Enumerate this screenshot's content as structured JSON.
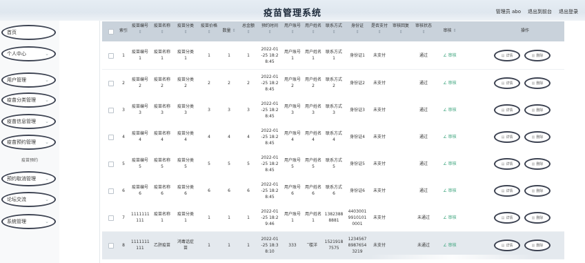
{
  "header": {
    "title": "疫苗管理系统",
    "user_label": "管理员 abo",
    "exit_to_front": "退出到前台",
    "logout": "退出登录"
  },
  "sidebar": {
    "items": [
      {
        "label": "首页",
        "chevron": ""
      },
      {
        "label": "个人中心",
        "chevron": "⌄"
      },
      {
        "label": "用户管理",
        "chevron": "⌄"
      },
      {
        "label": "疫苗分类管理",
        "chevron": "⌄"
      },
      {
        "label": "疫苗信息管理",
        "chevron": "⌄"
      },
      {
        "label": "疫苗预约管理",
        "chevron": "⌄"
      },
      {
        "label": "预约取消管理",
        "chevron": "⌄"
      },
      {
        "label": "论坛交流",
        "chevron": "⌄"
      },
      {
        "label": "系统管理",
        "chevron": "⌄"
      }
    ],
    "sub_item": "疫苗预约"
  },
  "table": {
    "columns": {
      "index": "索引",
      "vaccine_no": "疫苗编号",
      "vaccine_name": "疫苗名称",
      "vaccine_cat": "疫苗分类",
      "vaccine_price": "疫苗价格",
      "quantity": "数量",
      "total": "总金额",
      "time": "预约时间",
      "account": "用户账号",
      "name": "用户姓名",
      "contact": "联系方式",
      "idcard": "身份证",
      "paid": "是否支付",
      "reply": "审核回复",
      "status": "审核状态",
      "audit": "审核",
      "ops": "操作"
    },
    "sort_glyph": "⇕",
    "edit_label": "审核",
    "detail_label": "详情",
    "delete_label": "删除",
    "rows": [
      {
        "idx": "1",
        "no": "疫苗编号\n1",
        "name": "疫苗名称\n1",
        "cat": "疫苗分类\n1",
        "price": "1",
        "qty": "1",
        "total": "1",
        "time": "2022-01\n-25 18:2\n8:45",
        "acct": "用户账号\n1",
        "uname": "用户姓名\n1",
        "contact": "联系方式\n1",
        "idcard": "身份证1",
        "paid": "未支付",
        "reply": "",
        "status": "通过"
      },
      {
        "idx": "2",
        "no": "疫苗编号\n2",
        "name": "疫苗名称\n2",
        "cat": "疫苗分类\n2",
        "price": "2",
        "qty": "2",
        "total": "2",
        "time": "2022-01\n-25 18:2\n8:45",
        "acct": "用户账号\n2",
        "uname": "用户姓名\n2",
        "contact": "联系方式\n2",
        "idcard": "身份证2",
        "paid": "未支付",
        "reply": "",
        "status": "通过"
      },
      {
        "idx": "3",
        "no": "疫苗编号\n3",
        "name": "疫苗名称\n3",
        "cat": "疫苗分类\n3",
        "price": "3",
        "qty": "3",
        "total": "3",
        "time": "2022-01\n-25 18:2\n8:45",
        "acct": "用户账号\n3",
        "uname": "用户姓名\n3",
        "contact": "联系方式\n3",
        "idcard": "身份证3",
        "paid": "未支付",
        "reply": "",
        "status": "通过"
      },
      {
        "idx": "4",
        "no": "疫苗编号\n4",
        "name": "疫苗名称\n4",
        "cat": "疫苗分类\n4",
        "price": "4",
        "qty": "4",
        "total": "4",
        "time": "2022-01\n-25 18:2\n8:45",
        "acct": "用户账号\n4",
        "uname": "用户姓名\n4",
        "contact": "联系方式\n4",
        "idcard": "身份证4",
        "paid": "未支付",
        "reply": "",
        "status": "通过"
      },
      {
        "idx": "5",
        "no": "疫苗编号\n5",
        "name": "疫苗名称\n5",
        "cat": "疫苗分类\n5",
        "price": "5",
        "qty": "5",
        "total": "5",
        "time": "2022-01\n-25 18:2\n8:45",
        "acct": "用户账号\n5",
        "uname": "用户姓名\n5",
        "contact": "联系方式\n5",
        "idcard": "身份证5",
        "paid": "未支付",
        "reply": "",
        "status": "通过"
      },
      {
        "idx": "6",
        "no": "疫苗编号\n6",
        "name": "疫苗名称\n6",
        "cat": "疫苗分类\n6",
        "price": "6",
        "qty": "6",
        "total": "6",
        "time": "2022-01\n-25 18:2\n8:45",
        "acct": "用户账号\n6",
        "uname": "用户姓名\n6",
        "contact": "联系方式\n6",
        "idcard": "身份证6",
        "paid": "未支付",
        "reply": "",
        "status": "通过"
      },
      {
        "idx": "7",
        "no": "1111111\n111",
        "name": "疫苗名称\n1",
        "cat": "疫苗分类\n1",
        "price": "1",
        "qty": "1",
        "total": "1",
        "time": "2022-01\n-25 18:2\n9:46",
        "acct": "用户账号\n1",
        "uname": "用户姓名\n1",
        "contact": "1382388\n8881",
        "idcard": "4403001\n9910101\n0001",
        "paid": "未支付",
        "reply": "",
        "status": "未通过"
      },
      {
        "idx": "8",
        "no": "1111111\n111",
        "name": "乙肝疫苗",
        "cat": "鸿毒话症\n苗",
        "price": "1",
        "qty": "1",
        "total": "1",
        "time": "2022-01\n-25 18:3\n8:10",
        "acct": "333",
        "uname": "̅楼洋",
        "contact": "1521918\n7575",
        "idcard": "1234567\n8987654\n3219",
        "paid": "未支付",
        "reply": "",
        "status": "未通过"
      }
    ]
  }
}
